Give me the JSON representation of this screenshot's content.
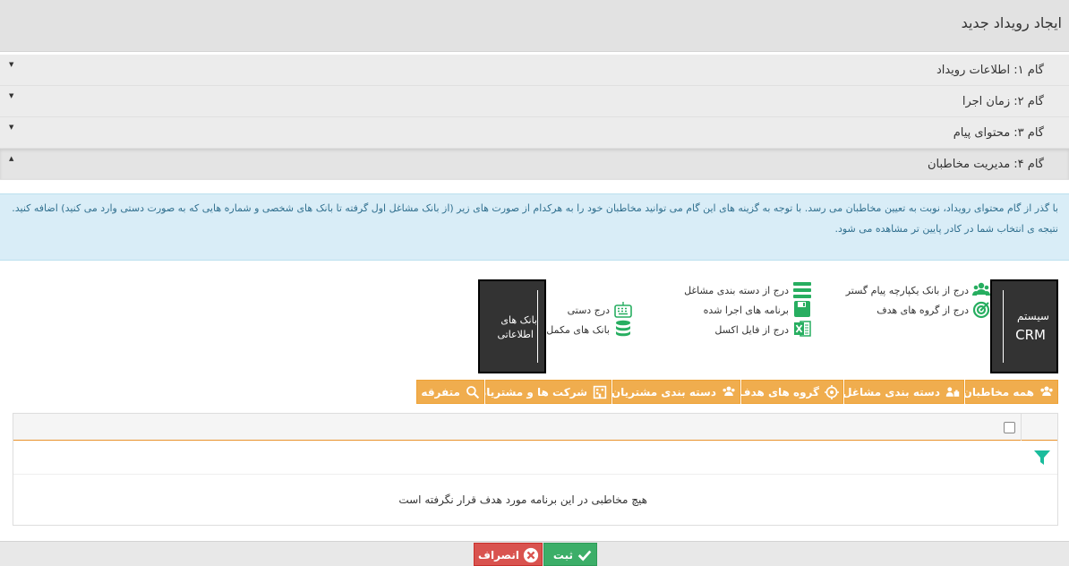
{
  "page": {
    "title": "ایجاد رویداد جدید"
  },
  "steps": [
    {
      "label": "گام ۱: اطلاعات رویداد",
      "caret": "▼"
    },
    {
      "label": "گام ۲: زمان اجرا",
      "caret": "▼"
    },
    {
      "label": "گام ۳: محتوای پیام",
      "caret": "▼"
    },
    {
      "label": "گام ۴: مدیریت مخاطبان",
      "caret": "▲"
    }
  ],
  "info": {
    "text": "با گذر از گام محتوای رویداد، نوبت به تعیین مخاطبان می رسد. با توجه به گزینه های این گام می توانید مخاطبان خود را به هرکدام از صورت های زیر (از بانک مشاغل اول گرفته تا بانک های شخصی و شماره هایی که به صورت دستی وارد می کنید) اضافه کنید. نتیجه ی انتخاب شما در کادر پایین تر مشاهده می شود."
  },
  "sources": {
    "crm": {
      "line1": "سیستم",
      "line2": "CRM"
    },
    "databanks": {
      "line1": "بانک های",
      "line2": "اطلاعاتی"
    },
    "crm_items": [
      {
        "label": "درج از بانک یکپارچه پیام گستر",
        "icon": "users-icon"
      },
      {
        "label": "درج از گروه های هدف",
        "icon": "target-icon"
      },
      {
        "label": "درج از دسته بندی مشاغل",
        "icon": "list-icon"
      },
      {
        "label": "برنامه های اجرا شده",
        "icon": "floppy-icon"
      },
      {
        "label": "درج از فایل اکسل",
        "icon": "excel-icon"
      }
    ],
    "db_items": [
      {
        "label": "درج دستی",
        "icon": "keyboard-icon"
      },
      {
        "label": "بانک های مکمل",
        "icon": "database-icon"
      }
    ]
  },
  "tabs": [
    {
      "label": "همه مخاطبان",
      "icon": "users-icon"
    },
    {
      "label": "دسته بندی مشاغل",
      "icon": "job-category-icon"
    },
    {
      "label": "گروه های هدف",
      "icon": "target-icon"
    },
    {
      "label": "دسته بندی مشتریان",
      "icon": "customers-icon"
    },
    {
      "label": "شرکت ها و مشتریان",
      "icon": "building-icon"
    },
    {
      "label": "متفرقه",
      "icon": "search-icon"
    }
  ],
  "grid": {
    "empty_message": "هیچ مخاطبی در این برنامه مورد هدف قرار نگرفته است"
  },
  "actions": {
    "save": "ثبت",
    "cancel": "انصراف"
  },
  "colors": {
    "accent": "#f0ad4e",
    "success": "#3cae68",
    "danger": "#d9534f",
    "icon_green": "#27ae60",
    "info_bg": "#d9edf7"
  }
}
